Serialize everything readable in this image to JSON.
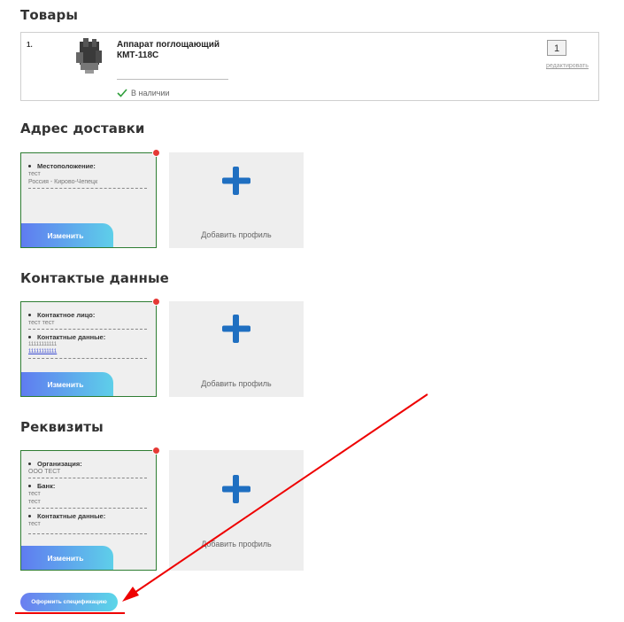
{
  "sections": {
    "goods_title": "Товары",
    "address_title": "Адрес доставки",
    "contacts_title": "Контактые данные",
    "requisites_title": "Реквизиты"
  },
  "product": {
    "number": "1.",
    "name": "Аппарат поглощающий КМТ-118С",
    "stock": "В наличии",
    "quantity": "1",
    "edit_link": "редактировать"
  },
  "address_card": {
    "field1_label": "Местоположение:",
    "field1_value1": "тест",
    "field1_value2": "Россия - Кирово-Чепецк",
    "edit": "Изменить"
  },
  "contacts_card": {
    "field1_label": "Контактное лицо:",
    "field1_value": "тест тест",
    "field2_label": "Контактные данные:",
    "field2_value1": "11111111111",
    "field2_value2": "11111111111",
    "edit": "Изменить"
  },
  "requisites_card": {
    "field1_label": "Организация:",
    "field1_value": "ООО ТЕСТ",
    "field2_label": "Банк:",
    "field2_value1": "тест",
    "field2_value2": "тест",
    "field3_label": "Контактные данные:",
    "field3_value": "тест",
    "edit": "Изменить"
  },
  "add_profile": "Добавить профиль",
  "submit": "Оформить спецификацию",
  "colors": {
    "card_border": "#2e7d32",
    "badge": "#e53935",
    "plus": "#1f6fc1",
    "annotation": "#e00000"
  }
}
